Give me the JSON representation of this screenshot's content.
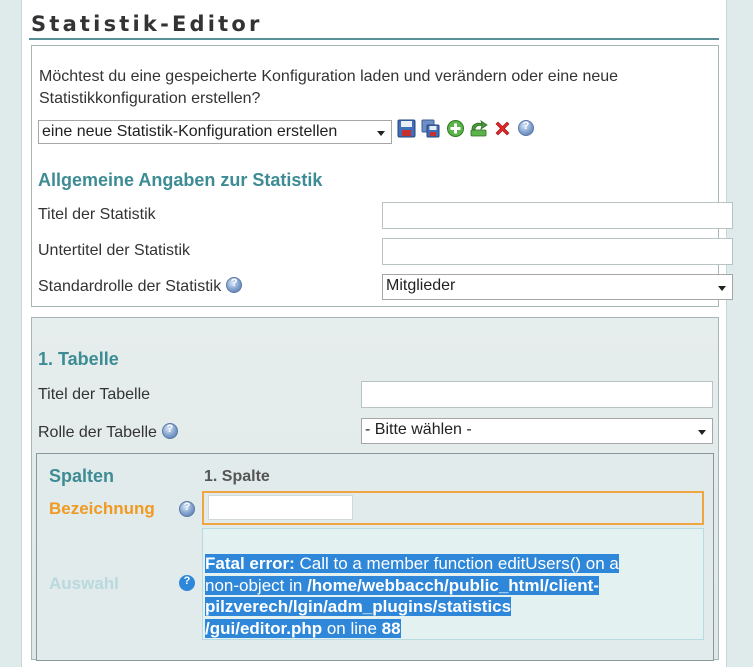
{
  "page": {
    "title": "Statistik-Editor",
    "intro": "Möchtest du eine gespeicherte Konfiguration laden und verändern oder eine neue Statistikkonfiguration erstellen?",
    "config_select": {
      "value": "eine neue Statistik-Konfiguration erstellen"
    },
    "toolbar_icons": [
      "save-icon",
      "save-as-icon",
      "add-icon",
      "reload-icon",
      "delete-icon",
      "help-icon"
    ]
  },
  "general": {
    "title": "Allgemeine Angaben zur Statistik",
    "title_label": "Titel der Statistik",
    "title_value": "",
    "subtitle_label": "Untertitel der Statistik",
    "subtitle_value": "",
    "role_label": "Standardrolle der Statistik",
    "role_value": "Mitglieder"
  },
  "table": {
    "title": "1. Tabelle",
    "title_label": "Titel der Tabelle",
    "title_value": "",
    "role_label": "Rolle der Tabelle",
    "role_value": "- Bitte wählen -",
    "columns": {
      "title": "Spalten",
      "column_header": "1. Spalte",
      "name_label": "Bezeichnung",
      "name_value": "",
      "select_label": "Auswahl",
      "error": {
        "line1_bold": "Fatal error:",
        "line1_rest": " Call to a member function editUsers() on a",
        "line2a": "non-object in ",
        "line2b": "/home/webbacch/public_html/client-",
        "line3": "pilzverech/lgin/adm_plugins/statistics",
        "line4a": "/gui/editor.php",
        "line4b": " on line ",
        "line4c": "88"
      }
    }
  },
  "colors": {
    "accent": "#3d8c94",
    "orange": "#f0a640",
    "selection": "#2f87d9",
    "muted_label": "#b9d9df"
  }
}
